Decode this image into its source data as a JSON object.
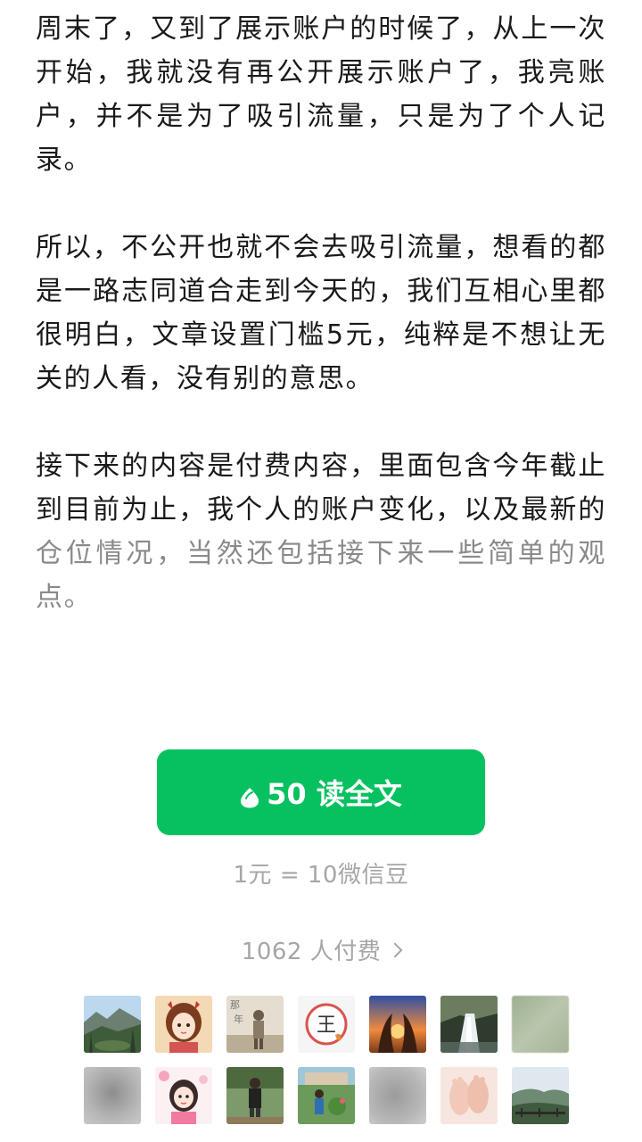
{
  "article": {
    "paragraphs": [
      "周末了，又到了展示账户的时候了，从上一次开始，我就没有再公开展示账户了，我亮账户，并不是为了吸引流量，只是为了个人记录。",
      "所以，不公开也就不会去吸引流量，想看的都是一路志同道合走到今天的，我们互相心里都很明白，文章设置门槛5元，纯粹是不想让无关的人看，没有别的意思。"
    ],
    "paragraph3_main": "接下来的内容是付费内容，里面包含今年截止到目前为止，我个人的账户变化，以及最新的",
    "paragraph3_faded": "仓位情况，当然还包括接下来一些简单的观点。"
  },
  "paywall": {
    "button_label": "50 读全文",
    "button_icon": "wechat-bean-icon",
    "rate_text": "1元 = 10微信豆",
    "payers_text": "1062 人付费",
    "accent_color": "#07c160",
    "avatars": [
      {
        "name": "avatar-mountain-valley"
      },
      {
        "name": "avatar-cartoon-girl"
      },
      {
        "name": "avatar-sepia-figure"
      },
      {
        "name": "avatar-king-emblem"
      },
      {
        "name": "avatar-sunset-hands"
      },
      {
        "name": "avatar-waterfall"
      },
      {
        "name": "avatar-blurred-green"
      },
      {
        "name": "avatar-blurred-gray"
      },
      {
        "name": "avatar-cartoon-flowers"
      },
      {
        "name": "avatar-person-standing"
      },
      {
        "name": "avatar-garden-person"
      },
      {
        "name": "avatar-blurred-gray-2"
      },
      {
        "name": "avatar-baby-feet"
      },
      {
        "name": "avatar-hill-landscape"
      }
    ]
  }
}
